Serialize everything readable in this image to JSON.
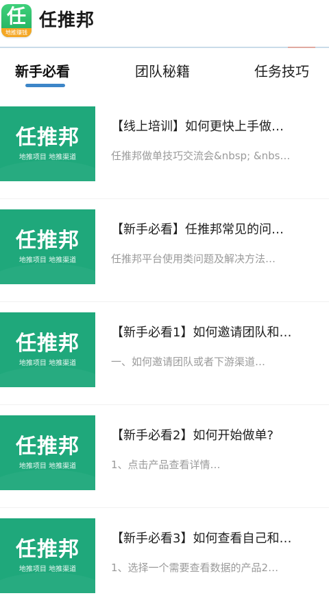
{
  "header": {
    "app_name": "任推邦",
    "logo_char": "任",
    "logo_strip_text": "地推赚钱"
  },
  "tabs": [
    {
      "label": "新手必看",
      "active": true
    },
    {
      "label": "团队秘籍",
      "active": false
    },
    {
      "label": "任务技巧",
      "active": false
    }
  ],
  "thumbnail": {
    "brand": "任推邦",
    "subtitle": "地推项目  地推渠道"
  },
  "articles": [
    {
      "title": "【线上培训】如何更快上手做…",
      "desc": "任推邦做单技巧交流会&nbsp; &nbs…"
    },
    {
      "title": "【新手必看】任推邦常见的问…",
      "desc": "任推邦平台使用类问题及解决方法…"
    },
    {
      "title": "【新手必看1】如何邀请团队和…",
      "desc": "一、如何邀请团队或者下游渠道…"
    },
    {
      "title": "【新手必看2】如何开始做单?",
      "desc": "1、点击产品查看详情…"
    },
    {
      "title": "【新手必看3】如何查看自己和…",
      "desc": "1、选择一个需要查看数据的产品2…"
    }
  ],
  "colors": {
    "brand_green": "#1fa87b",
    "tab_indicator": "#3d86c8"
  }
}
